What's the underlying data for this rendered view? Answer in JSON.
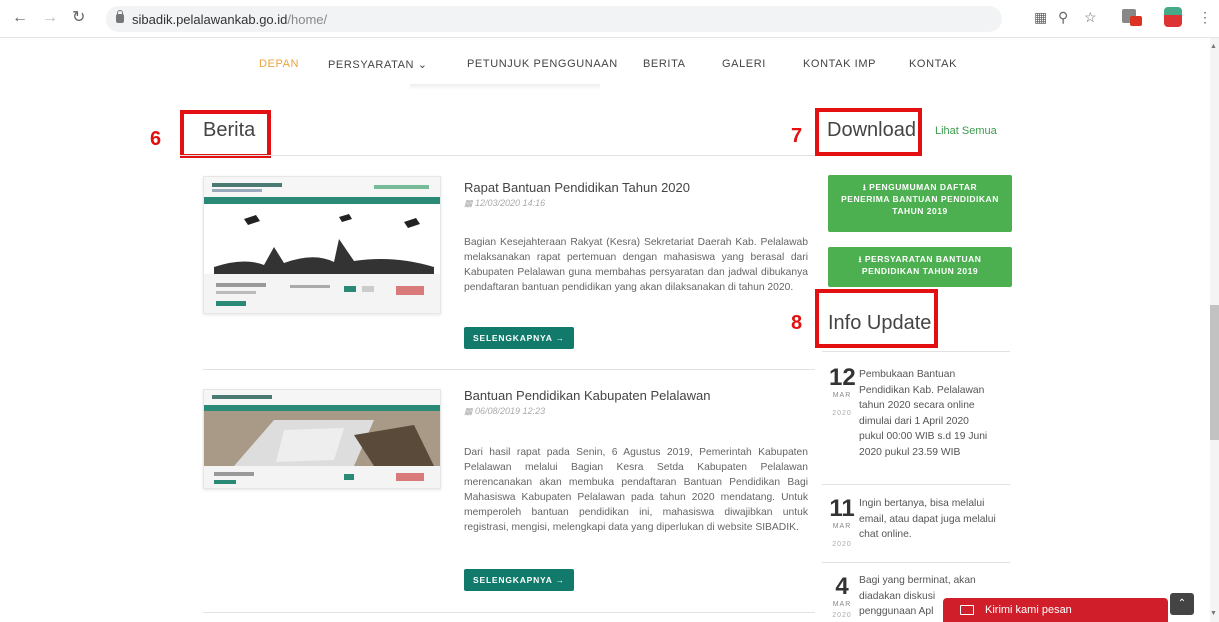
{
  "browser": {
    "url_host": "sibadik.pelalawankab.go.id",
    "url_path": "/home/"
  },
  "menu": {
    "items": [
      "DEPAN",
      "PERSYARATAN ⌄",
      "PETUNJUK PENGGUNAAN",
      "BERITA",
      "GALERI",
      "KONTAK IMP",
      "KONTAK"
    ]
  },
  "annotations": {
    "berita": "6",
    "download": "7",
    "info": "8"
  },
  "berita": {
    "title": "Berita",
    "news": [
      {
        "title": "Rapat Bantuan Pendidikan Tahun 2020",
        "date": "12/03/2020 14:16",
        "body": "Bagian Kesejahteraan Rakyat (Kesra) Sekretariat Daerah Kab. Pelalawab melaksanakan rapat pertemuan dengan mahasiswa yang berasal dari Kabupaten Pelalawan guna membahas persyaratan dan jadwal dibukanya pendaftaran bantuan pendidikan yang akan dilaksanakan di tahun 2020.",
        "button": "SELENGKAPNYA →"
      },
      {
        "title": "Bantuan Pendidikan Kabupaten Pelalawan",
        "date": "06/08/2019 12:23",
        "body": "Dari hasil rapat pada Senin, 6 Agustus 2019, Pemerintah Kabupaten Pelalawan melalui Bagian Kesra Setda Kabupaten Pelalawan merencanakan akan membuka pendaftaran Bantuan Pendidikan Bagi Mahasiswa Kabupaten Pelalawan pada tahun 2020 mendatang. Untuk memperoleh bantuan pendidikan ini, mahasiswa diwajibkan untuk registrasi, mengisi, melengkapi data yang diperlukan di website SIBADIK.",
        "button": "SELENGKAPNYA →"
      }
    ]
  },
  "download": {
    "title": "Download",
    "see_all": "Lihat Semua",
    "items": [
      "⭳ PENGUMUMAN DAFTAR PENERIMA BANTUAN PENDIDIKAN TAHUN 2019",
      "⭳ PERSYARATAN BANTUAN PENDIDIKAN TAHUN 2019"
    ]
  },
  "info": {
    "title": "Info Update",
    "items": [
      {
        "day": "12",
        "month": "MAR",
        "year": "2020",
        "text": "Pembukaan Bantuan Pendidikan Kab. Pelalawan tahun 2020 secara online dimulai dari 1 April 2020 pukul 00:00 WIB s.d 19 Juni 2020 pukul 23.59 WIB"
      },
      {
        "day": "11",
        "month": "MAR",
        "year": "2020",
        "text": "Ingin bertanya, bisa melalui email, atau dapat juga melalui chat online."
      },
      {
        "day": "4",
        "month": "MAR",
        "year": "2020",
        "text": "Bagi yang berminat, akan diadakan diskusi penggunaan Apl"
      }
    ]
  },
  "chat": {
    "label": "Kirimi kami pesan",
    "to_top": "⌃"
  }
}
